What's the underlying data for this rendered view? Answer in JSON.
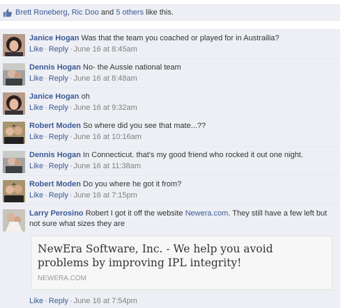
{
  "likes": {
    "names": [
      "Brett Roneberg",
      "Ric Doo"
    ],
    "separator": ",",
    "conjunction": "and",
    "others": "5 others",
    "suffix": "like this."
  },
  "actions": {
    "like": "Like",
    "reply": "Reply",
    "dot": "·"
  },
  "comments": [
    {
      "author": "Janice Hogan",
      "text": "Was that the team you coached or played for in Austrailia?",
      "time": "June 16 at 8:45am"
    },
    {
      "author": "Dennis Hogan",
      "text": "No- the Aussie national team",
      "time": "June 16 at 8:48am"
    },
    {
      "author": "Janice Hogan",
      "text": "oh",
      "time": "June 16 at 9:32am"
    },
    {
      "author": "Robert Moden",
      "text": "So where did you see that mate...??",
      "time": "June 16 at 10:16am"
    },
    {
      "author": "Dennis Hogan",
      "text": "In Connecticut. that's my good friend who rocked it out one night.",
      "time": "June 16 at 11:38am"
    },
    {
      "author": "Robert Moden",
      "text": "Do you where he got it from?",
      "time": "June 16 at 7:15pm"
    },
    {
      "author": "Larry Perosino",
      "text_before": "Robert I got it off the website",
      "link": "Newera.com",
      "text_after": ". They still have a few left but not sure what sizes they are",
      "time": "June 16 at 7:54pm"
    }
  ],
  "attachment": {
    "title": "NewEra Software, Inc. - We help you avoid problems by improving IPL integrity!",
    "domain": "NEWERA.COM"
  },
  "colors": {
    "link": "#3b5998",
    "background": "#edeff4",
    "meta": "#808080"
  }
}
